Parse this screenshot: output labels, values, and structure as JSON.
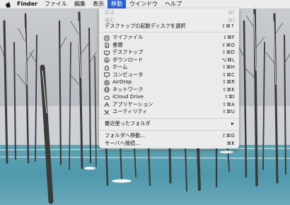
{
  "menubar": {
    "finder": "Finder",
    "file": "ファイル",
    "edit": "編集",
    "view": "表示",
    "go": "移動",
    "window": "ウインドウ",
    "help": "ヘルプ",
    "active_color": "#2a63d4"
  },
  "go_menu": {
    "back": {
      "label": "戻る",
      "shortcut": "⌘["
    },
    "forward": {
      "label": "進む",
      "shortcut": "⌘]"
    },
    "startup_disk": {
      "label": "デスクトップの起動ディスクを選択",
      "shortcut": "⇧⌘↑"
    },
    "places": [
      {
        "icon": "my-files-icon",
        "label": "マイファイル",
        "shortcut": "⇧⌘F"
      },
      {
        "icon": "documents-icon",
        "label": "書類",
        "shortcut": "⇧⌘O"
      },
      {
        "icon": "desktop-icon",
        "label": "デスクトップ",
        "shortcut": "⇧⌘D"
      },
      {
        "icon": "downloads-icon",
        "label": "ダウンロード",
        "shortcut": "⌥⌘L"
      },
      {
        "icon": "home-icon",
        "label": "ホーム",
        "shortcut": "⇧⌘H"
      },
      {
        "icon": "computer-icon",
        "label": "コンピュータ",
        "shortcut": "⇧⌘C"
      },
      {
        "icon": "airdrop-icon",
        "label": "AirDrop",
        "shortcut": "⇧⌘R"
      },
      {
        "icon": "network-icon",
        "label": "ネットワーク",
        "shortcut": "⇧⌘K"
      },
      {
        "icon": "icloud-drive-icon",
        "label": "iCloud Drive",
        "shortcut": "⇧⌘I"
      },
      {
        "icon": "applications-icon",
        "label": "アプリケーション",
        "shortcut": "⇧⌘A"
      },
      {
        "icon": "utilities-icon",
        "label": "ユーティリティ",
        "shortcut": "⇧⌘U"
      }
    ],
    "recent_folders": {
      "label": "最近使ったフォルダ"
    },
    "goto_folder": {
      "label": "フォルダへ移動...",
      "shortcut": "⇧⌘G"
    },
    "connect_server": {
      "label": "サーバへ接続...",
      "shortcut": "⌘K"
    }
  }
}
